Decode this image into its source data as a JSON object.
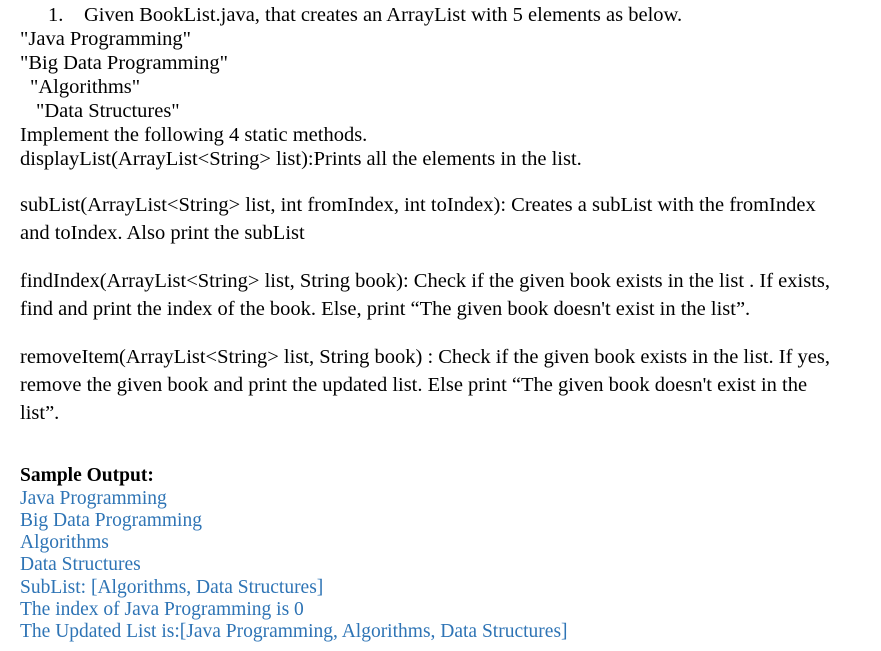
{
  "document": {
    "task": {
      "number": "1.",
      "text": "Given BookList.java, that creates an ArrayList with 5 elements as below."
    },
    "array_elements": [
      {
        "text": "\"Java Programming\"",
        "indent": 0
      },
      {
        "text": "\"Big Data Programming\"",
        "indent": 0
      },
      {
        "text": "\"Algorithms\"",
        "indent": 1
      },
      {
        "text": "\"Data Structures\"",
        "indent": 2
      }
    ],
    "instruction": "Implement the following 4 static methods.",
    "methods": [
      {
        "name": "displayList",
        "text": "displayList(ArrayList<String> list):Prints all the elements in the list.",
        "style": "line"
      },
      {
        "name": "subList",
        "text": "subList(ArrayList<String> list, int fromIndex, int toIndex): Creates a subList with the fromIndex and toIndex. Also print the subList",
        "style": "paragraph"
      },
      {
        "name": "findIndex",
        "text": "findIndex(ArrayList<String> list, String book): Check if the given book exists in the list . If exists, find and print the index of  the book. Else, print “The given book doesn't exist in the list”.",
        "style": "paragraph"
      },
      {
        "name": "removeItem",
        "text": "removeItem(ArrayList<String> list, String book) : Check if the given book exists in the list. If yes, remove the given book and print the updated list. Else print “The given book doesn't exist in the list”.",
        "style": "paragraph"
      }
    ],
    "sample_output": {
      "heading": "Sample Output:",
      "color": "#2E74B5",
      "lines": [
        "Java Programming",
        "Big Data Programming",
        "Algorithms",
        "Data Structures",
        "SubList: [Algorithms, Data Structures]",
        "The index of Java Programming is 0",
        "The Updated List is:[Java Programming, Algorithms, Data Structures]"
      ]
    }
  }
}
